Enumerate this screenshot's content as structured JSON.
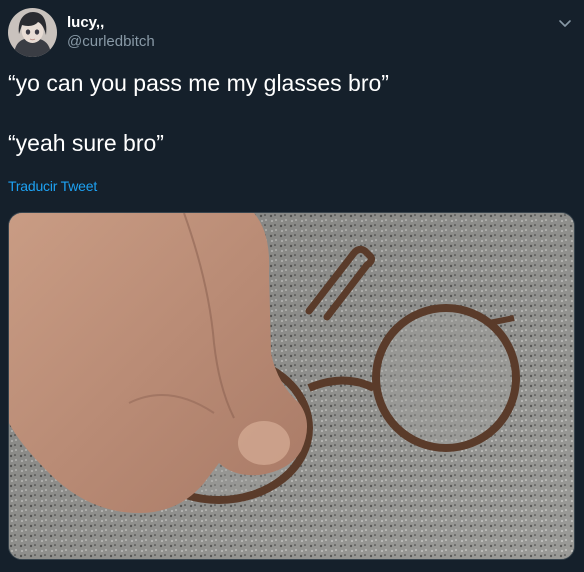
{
  "tweet": {
    "author": {
      "display_name": "lucy,,",
      "handle": "@curledbitch",
      "avatar_icon": "avatar-illustration"
    },
    "lines": [
      "“yo can you pass me my glasses bro”",
      "“yeah sure bro”"
    ],
    "translate_label": "Traducir Tweet",
    "menu_icon": "chevron-down-icon"
  },
  "colors": {
    "background": "#15202b",
    "text": "#ffffff",
    "secondary": "#8899a6",
    "link": "#1da1f2",
    "border": "#38444d"
  }
}
